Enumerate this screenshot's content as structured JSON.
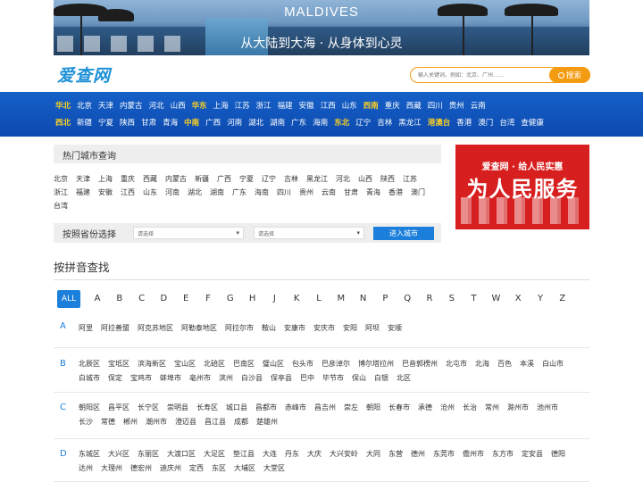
{
  "banner": {
    "title": "MALDIVES",
    "subtitle": "从大陆到大海 · 从身体到心灵"
  },
  "logo": "爱查网",
  "search": {
    "placeholder": "输入关键词，例如：北京、广州……",
    "button": "搜索"
  },
  "regions": {
    "row1": [
      {
        "t": "华北",
        "hl": true
      },
      {
        "t": "北京"
      },
      {
        "t": "天津"
      },
      {
        "t": "内蒙古"
      },
      {
        "t": "河北"
      },
      {
        "t": "山西"
      },
      {
        "t": "华东",
        "hl": true
      },
      {
        "t": "上海"
      },
      {
        "t": "江苏"
      },
      {
        "t": "浙江"
      },
      {
        "t": "福建"
      },
      {
        "t": "安徽"
      },
      {
        "t": "江西"
      },
      {
        "t": "山东"
      },
      {
        "t": "西南",
        "hl": true
      },
      {
        "t": "重庆"
      },
      {
        "t": "西藏"
      },
      {
        "t": "四川"
      },
      {
        "t": "贵州"
      },
      {
        "t": "云南"
      }
    ],
    "row2": [
      {
        "t": "西北",
        "hl": true
      },
      {
        "t": "新疆"
      },
      {
        "t": "宁夏"
      },
      {
        "t": "陕西"
      },
      {
        "t": "甘肃"
      },
      {
        "t": "青海"
      },
      {
        "t": "中南",
        "hl": true
      },
      {
        "t": "广西"
      },
      {
        "t": "河南"
      },
      {
        "t": "湖北"
      },
      {
        "t": "湖南"
      },
      {
        "t": "广东"
      },
      {
        "t": "海南"
      },
      {
        "t": "东北",
        "hl": true
      },
      {
        "t": "辽宁"
      },
      {
        "t": "吉林"
      },
      {
        "t": "黑龙江"
      },
      {
        "t": "港澳台",
        "hl": true
      },
      {
        "t": "香港"
      },
      {
        "t": "澳门"
      },
      {
        "t": "台湾"
      },
      {
        "t": "查健康"
      }
    ]
  },
  "hot": {
    "title": "热门城市查询",
    "cities": [
      "北京",
      "天津",
      "上海",
      "重庆",
      "西藏",
      "内蒙古",
      "新疆",
      "广西",
      "宁夏",
      "辽宁",
      "吉林",
      "黑龙江",
      "河北",
      "山西",
      "陕西",
      "江苏",
      "浙江",
      "福建",
      "安徽",
      "江西",
      "山东",
      "河南",
      "湖北",
      "湖南",
      "广东",
      "海南",
      "四川",
      "贵州",
      "云南",
      "甘肃",
      "青海",
      "香港",
      "澳门",
      "台湾"
    ]
  },
  "province": {
    "label": "按照省份选择",
    "select1": "请选择",
    "select2": "请选择",
    "button": "进入城市"
  },
  "ad": {
    "top": "爱查网 · 给人民实惠",
    "main": "为人民服务"
  },
  "pinyin": {
    "title": "按拼音查找",
    "letters": [
      "ALL",
      "A",
      "B",
      "C",
      "D",
      "E",
      "F",
      "G",
      "H",
      "J",
      "K",
      "L",
      "M",
      "N",
      "P",
      "Q",
      "R",
      "S",
      "T",
      "W",
      "X",
      "Y",
      "Z"
    ],
    "groups": [
      {
        "letter": "A",
        "cities": [
          "阿里",
          "阿拉善盟",
          "阿克苏地区",
          "阿勒泰地区",
          "阿拉尔市",
          "鞍山",
          "安康市",
          "安庆市",
          "安阳",
          "阿坝",
          "安顺"
        ]
      },
      {
        "letter": "B",
        "cities": [
          "北辰区",
          "宝坻区",
          "滨海新区",
          "宝山区",
          "北碚区",
          "巴南区",
          "璧山区",
          "包头市",
          "巴彦淖尔",
          "博尔塔拉州",
          "巴音郭楞州",
          "北屯市",
          "北海",
          "百色",
          "本溪",
          "白山市",
          "白城市",
          "保定",
          "宝鸡市",
          "蚌埠市",
          "亳州市",
          "滨州",
          "白沙县",
          "保亭县",
          "巴中",
          "毕节市",
          "保山",
          "白银",
          "北区"
        ]
      },
      {
        "letter": "C",
        "cities": [
          "朝阳区",
          "昌平区",
          "长宁区",
          "崇明县",
          "长寿区",
          "城口县",
          "昌都市",
          "赤峰市",
          "昌吉州",
          "崇左",
          "朝阳",
          "长春市",
          "承德",
          "沧州",
          "长治",
          "常州",
          "滁州市",
          "池州市",
          "长沙",
          "常德",
          "郴州",
          "潮州市",
          "澄迈县",
          "昌江县",
          "成都",
          "楚雄州"
        ]
      },
      {
        "letter": "D",
        "cities": [
          "东城区",
          "大兴区",
          "东丽区",
          "大渡口区",
          "大足区",
          "垫江县",
          "大连",
          "丹东",
          "大庆",
          "大兴安岭",
          "大同",
          "东营",
          "德州",
          "东莞市",
          "儋州市",
          "东方市",
          "定安县",
          "德阳",
          "达州",
          "大理州",
          "德宏州",
          "迪庆州",
          "定西",
          "东区",
          "大埔区",
          "大堂区"
        ]
      }
    ]
  }
}
